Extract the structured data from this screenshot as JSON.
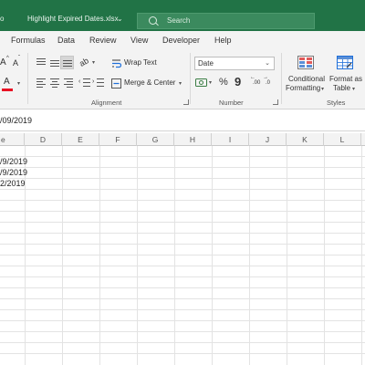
{
  "title_bar": {
    "left_fragment": "o",
    "file_name": "Highlight Expired Dates.xlsx",
    "file_caret": "⌄",
    "search_placeholder": "Search",
    "background": "#217346"
  },
  "menu": {
    "items": [
      "Formulas",
      "Data",
      "Review",
      "View",
      "Developer",
      "Help"
    ]
  },
  "ribbon": {
    "font": {
      "grow_label": "A",
      "shrink_label": "A",
      "font_color_label": "A",
      "font_color": "#e81123"
    },
    "alignment": {
      "group_label": "Alignment",
      "wrap_text_label": "Wrap Text",
      "merge_center_label": "Merge & Center"
    },
    "number": {
      "group_label": "Number",
      "format_value": "Date",
      "percent_label": "%",
      "comma_label": "9"
    },
    "styles": {
      "group_label": "Styles",
      "conditional_formatting_line1": "Conditional",
      "conditional_formatting_line2": "Formatting",
      "format_as_table_line1": "Format as",
      "format_as_table_line2": "Table"
    }
  },
  "formula_bar": {
    "content": "/09/2019"
  },
  "grid": {
    "column_headers": [
      "e",
      "D",
      "E",
      "F",
      "G",
      "H",
      "I",
      "J",
      "K",
      "L"
    ],
    "cells": [
      "/9/2019",
      "/9/2019",
      "2/2019"
    ]
  }
}
